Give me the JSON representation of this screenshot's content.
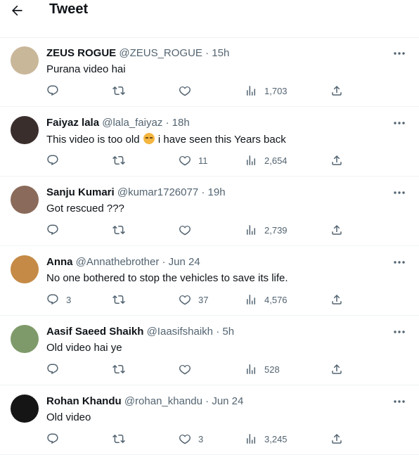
{
  "header": {
    "title": "Tweet"
  },
  "replies": [
    {
      "name": "ZEUS ROGUE",
      "handle": "@ZEUS_ROGUE",
      "time": "15h",
      "text": "Purana video hai",
      "emoji": false,
      "text_after": "",
      "replies": "",
      "likes": "",
      "views": "1,703",
      "avatar_color": "#c9b79a"
    },
    {
      "name": "Faiyaz lala",
      "handle": "@lala_faiyaz",
      "time": "18h",
      "text": "This video is too old",
      "emoji": true,
      "text_after": "i have seen this Years back",
      "replies": "",
      "likes": "11",
      "views": "2,654",
      "avatar_color": "#3a2e2c"
    },
    {
      "name": "Sanju Kumari",
      "handle": "@kumar1726077",
      "time": "19h",
      "text": "Got rescued ???",
      "emoji": false,
      "text_after": "",
      "replies": "",
      "likes": "",
      "views": "2,739",
      "avatar_color": "#8a6a5a"
    },
    {
      "name": "Anna",
      "handle": "@Annathebrother",
      "time": "Jun 24",
      "text": "No one bothered to stop the vehicles to save its life.",
      "emoji": false,
      "text_after": "",
      "replies": "3",
      "likes": "37",
      "views": "4,576",
      "avatar_color": "#c58a45"
    },
    {
      "name": "Aasif Saeed Shaikh",
      "handle": "@Iaasifshaikh",
      "time": "5h",
      "text": "Old video hai ye",
      "emoji": false,
      "text_after": "",
      "replies": "",
      "likes": "",
      "views": "528",
      "avatar_color": "#7f9a6a"
    },
    {
      "name": "Rohan Khandu",
      "handle": "@rohan_khandu",
      "time": "Jun 24",
      "text": "Old video",
      "emoji": false,
      "text_after": "",
      "replies": "",
      "likes": "3",
      "views": "3,245",
      "avatar_color": "#151515"
    }
  ],
  "icons": {
    "back": "back-arrow-icon",
    "more": "more-icon",
    "reply": "reply-icon",
    "retweet": "retweet-icon",
    "like": "like-icon",
    "views": "views-icon",
    "share": "share-icon"
  },
  "colors": {
    "text": "#0f1419",
    "muted": "#536471",
    "divider": "#eff3f4"
  }
}
